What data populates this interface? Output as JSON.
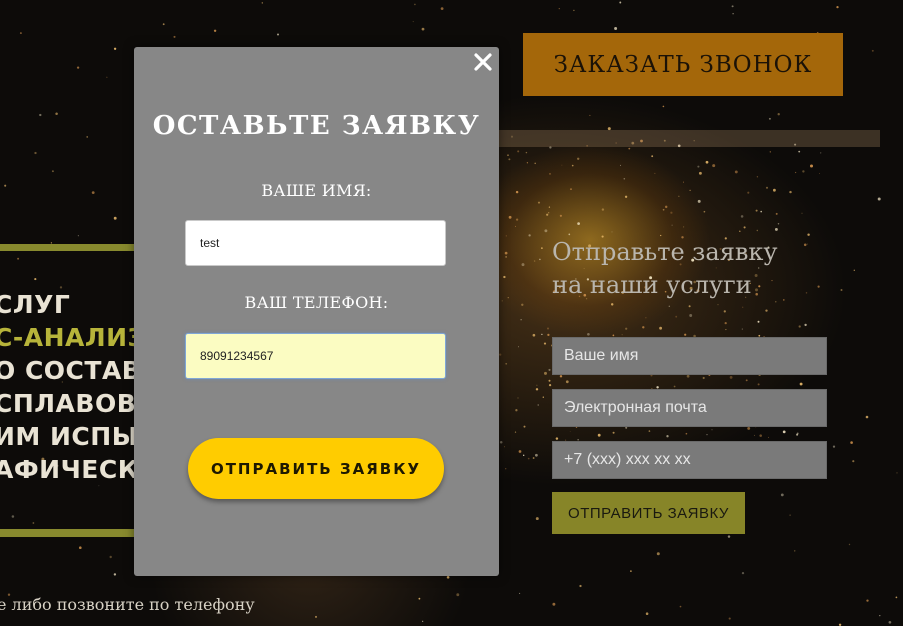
{
  "header": {
    "call_button_label": "ЗАКАЗАТЬ ЗВОНОК"
  },
  "services": {
    "lines": [
      {
        "text": "СЛУГ",
        "accent": false
      },
      {
        "text": "С-АНАЛИЗ",
        "accent": true
      },
      {
        "text": "О СОСТАВ",
        "accent": false
      },
      {
        "text": "СПЛАВОВ",
        "accent": false
      },
      {
        "text": "ИМ ИСПЫТ",
        "accent": false
      },
      {
        "text": "АФИЧЕСК",
        "accent": false
      }
    ]
  },
  "footer_note": "е либо позвоните по телефону",
  "side_form": {
    "heading_line1": "Отправьте заявку",
    "heading_line2": "на наши услуги",
    "name_placeholder": "Ваше имя",
    "email_placeholder": "Электронная почта",
    "phone_placeholder": "+7 (xxx) xxx xx xx",
    "submit_label": "ОТПРАВИТЬ ЗАЯВКУ"
  },
  "modal": {
    "close_icon": "close-icon",
    "title": "ОСТАВЬТЕ ЗАЯВКУ",
    "name_label": "ВАШЕ ИМЯ:",
    "name_value": "test",
    "phone_label": "ВАШ ТЕЛЕФОН:",
    "phone_value": "89091234567",
    "submit_label": "ОТПРАВИТЬ ЗАЯВКУ"
  },
  "colors": {
    "call_button": "#a4670a",
    "accent_olive": "#888a2e",
    "modal_bg": "#878787",
    "modal_submit": "#ffcc00",
    "phone_field_bg": "#fbfcc2"
  }
}
